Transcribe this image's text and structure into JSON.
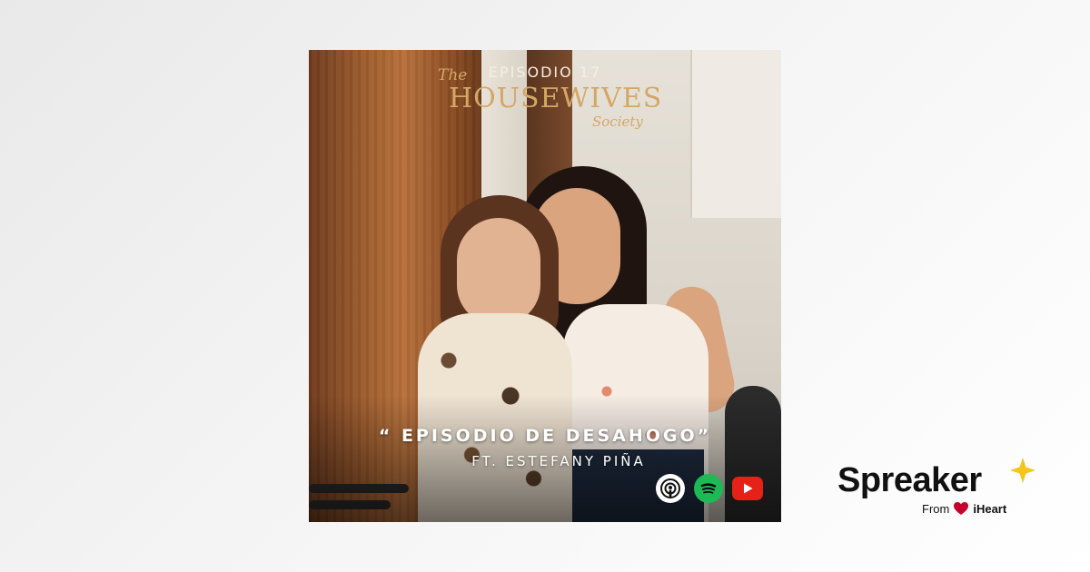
{
  "cover": {
    "episode_number": "EPISODIO 17",
    "logo": {
      "the": "The",
      "main": "HOUSEWIVES",
      "sub": "Society"
    },
    "title": "“ EPISODIO DE DESAHOGO”",
    "subtitle": "FT. ESTEFANY PIÑA",
    "platforms": [
      "apple-podcasts-icon",
      "spotify-icon",
      "youtube-icon"
    ]
  },
  "branding": {
    "name": "Spreaker",
    "from_label": "From",
    "partner": "iHeart",
    "star_color": "#f5c518",
    "heart_color": "#c6002b"
  }
}
